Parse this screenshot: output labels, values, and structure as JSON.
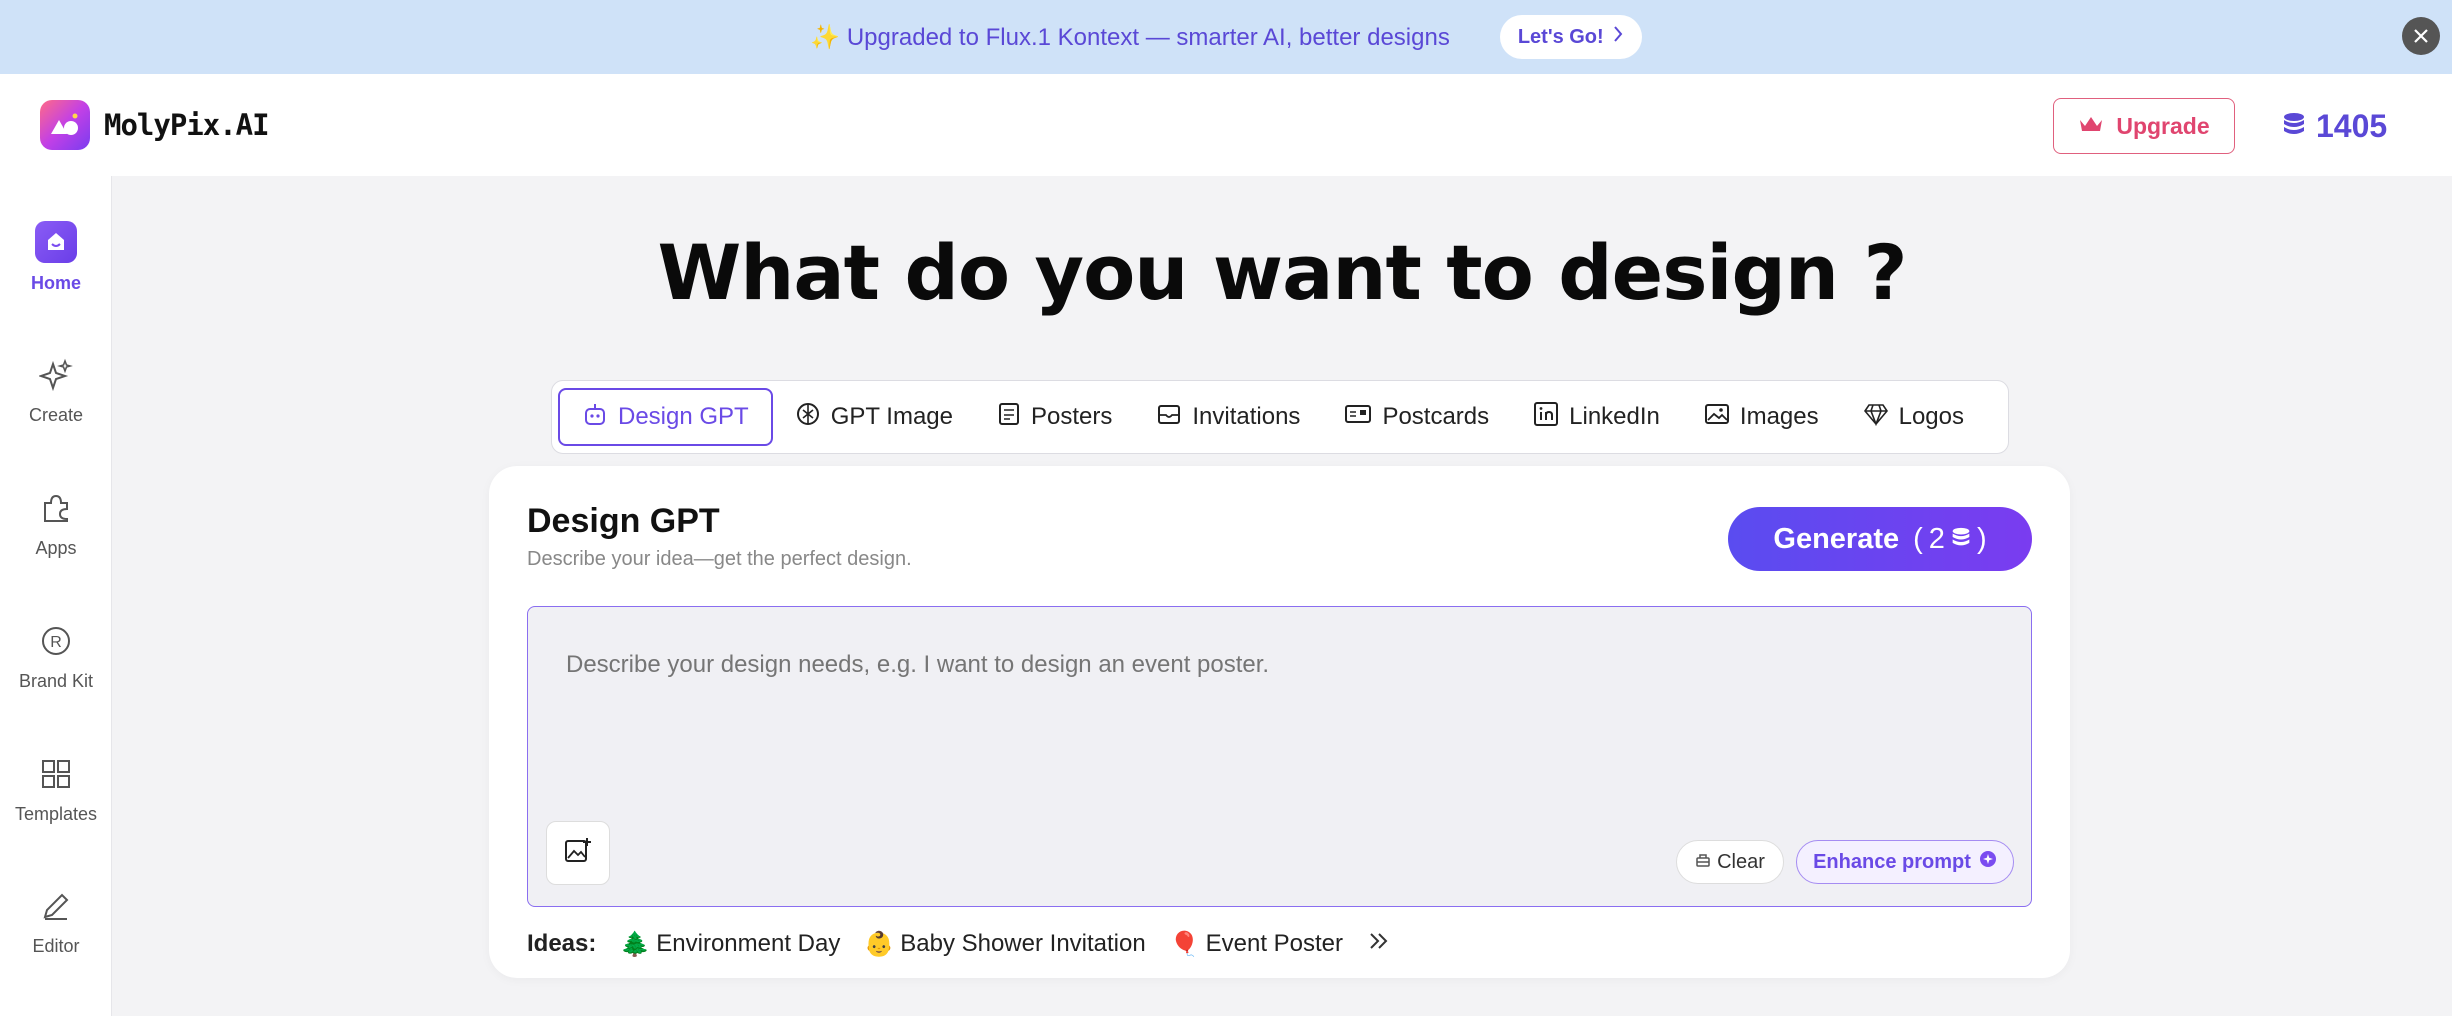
{
  "banner": {
    "text": "✨ Upgraded to Flux.1 Kontext — smarter AI, better designs",
    "cta": "Let's Go!"
  },
  "header": {
    "brand": "MolyPix.AI",
    "upgrade_label": "Upgrade",
    "credits": "1405"
  },
  "sidebar": {
    "items": [
      {
        "label": "Home",
        "icon": "home-icon"
      },
      {
        "label": "Create",
        "icon": "sparkles-icon"
      },
      {
        "label": "Apps",
        "icon": "puzzle-icon"
      },
      {
        "label": "Brand Kit",
        "icon": "registered-icon"
      },
      {
        "label": "Templates",
        "icon": "grid-icon"
      },
      {
        "label": "Editor",
        "icon": "pencil-icon"
      }
    ]
  },
  "main": {
    "headline": "What do you want to design ?",
    "tabs": [
      {
        "label": "Design GPT",
        "icon": "robot-icon"
      },
      {
        "label": "GPT Image",
        "icon": "openai-icon"
      },
      {
        "label": "Posters",
        "icon": "poster-icon"
      },
      {
        "label": "Invitations",
        "icon": "envelope-icon"
      },
      {
        "label": "Postcards",
        "icon": "postcard-icon"
      },
      {
        "label": "LinkedIn",
        "icon": "linkedin-icon"
      },
      {
        "label": "Images",
        "icon": "image-icon"
      },
      {
        "label": "Logos",
        "icon": "diamond-icon"
      }
    ],
    "active_tab": "Design GPT"
  },
  "card": {
    "title": "Design GPT",
    "subtitle": "Describe your idea—get the perfect design.",
    "generate_label": "Generate",
    "generate_cost": "2",
    "prompt_placeholder": "Describe your design needs, e.g. I want to design an event poster.",
    "clear_label": "Clear",
    "enhance_label": "Enhance prompt",
    "ideas_label": "Ideas:",
    "ideas": [
      {
        "emoji": "🌲",
        "label": "Environment Day"
      },
      {
        "emoji": "👶",
        "label": "Baby Shower Invitation"
      },
      {
        "emoji": "🎈",
        "label": "Event Poster"
      }
    ]
  },
  "colors": {
    "accent": "#6a4ae6",
    "banner_bg": "#cfe2f8",
    "upgrade": "#e0456f"
  }
}
